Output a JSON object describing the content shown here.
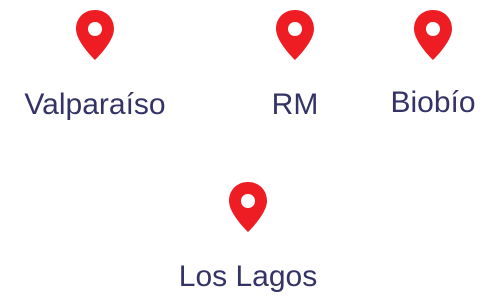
{
  "colors": {
    "pin": "#ee1d24",
    "label": "#333366"
  },
  "icons": {
    "pin": "map-pin-icon"
  },
  "locations": [
    {
      "label": "Valparaíso"
    },
    {
      "label": "RM"
    },
    {
      "label": "Biobío"
    },
    {
      "label": "Los Lagos"
    }
  ]
}
